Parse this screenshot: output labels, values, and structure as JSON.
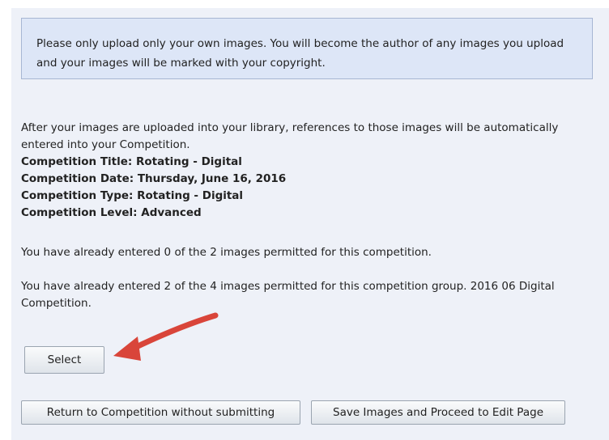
{
  "notice": {
    "text": "Please only upload only your own images. You will become the author of any images you upload and your images will be marked with your copyright."
  },
  "info": {
    "intro": "After your images are uploaded into your library, references to those images will be automatically entered into your Competition.",
    "title": "Competition Title: Rotating - Digital",
    "date": "Competition Date: Thursday, June 16, 2016",
    "type": "Competition Type: Rotating - Digital",
    "level": "Competition Level: Advanced",
    "entered_competition": "You have already entered 0 of the 2 images permitted for this competition.",
    "entered_group": "You have already entered 2 of the 4 images permitted for this competition group. 2016 06 Digital Competition."
  },
  "buttons": {
    "select": "Select",
    "return": "Return to Competition without submitting",
    "save": "Save Images and Proceed to Edit Page"
  },
  "colors": {
    "panel_background": "#eef1f8",
    "notice_background": "#dde6f7",
    "arrow": "#d9453a"
  }
}
